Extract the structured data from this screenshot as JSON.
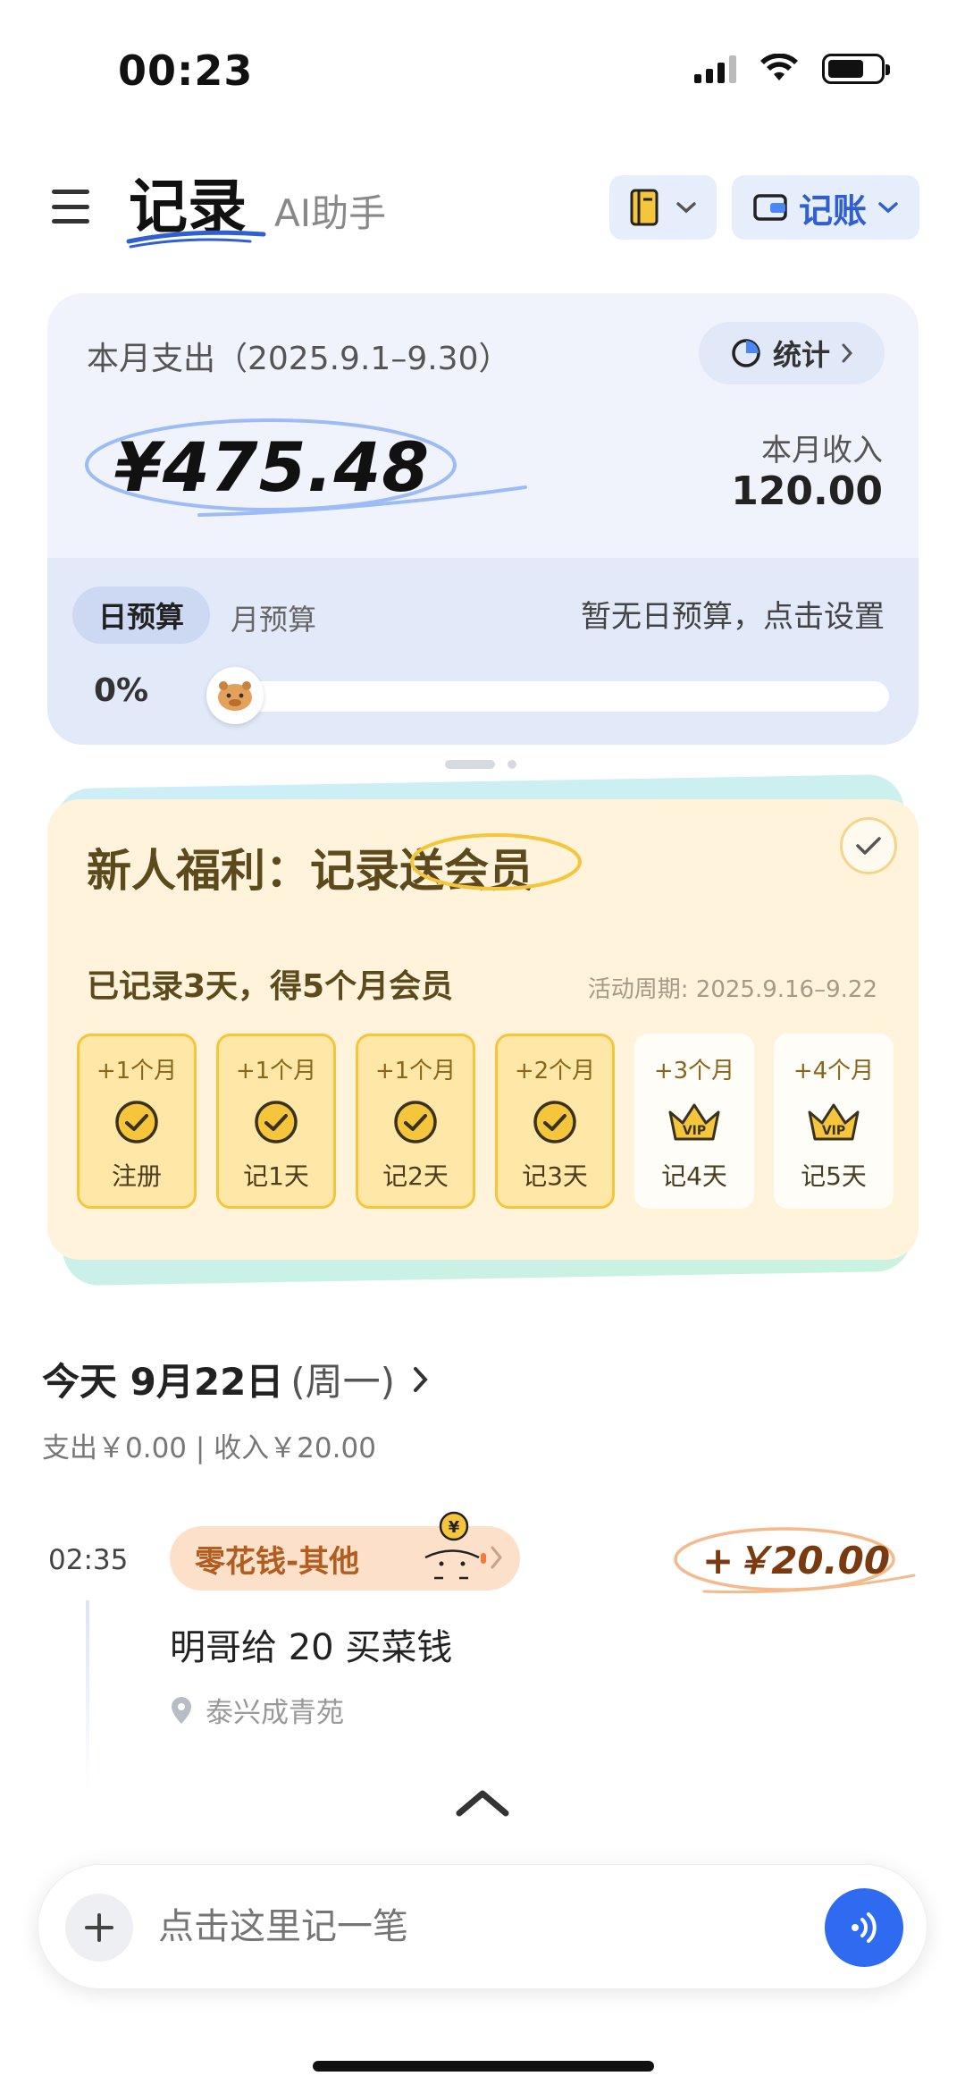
{
  "status_bar": {
    "time": "00:23"
  },
  "header": {
    "tab_record": "记录",
    "tab_ai": "AI助手",
    "account_label": "记账"
  },
  "summary": {
    "title": "本月支出（2025.9.1–9.30）",
    "stats_label": "统计",
    "amount": "¥475.48",
    "income_label": "本月收入",
    "income_value": "120.00",
    "budget_tab_day": "日预算",
    "budget_tab_month": "月预算",
    "budget_hint": "暂无日预算，点击设置",
    "budget_percent": "0%",
    "budget_progress": 0
  },
  "benefit": {
    "title_prefix": "新人福利：记录",
    "title_highlight": "送会员",
    "subtitle": "已记录3天，得5个月会员",
    "period": "活动周期: 2025.9.16–9.22",
    "rewards": [
      {
        "plus": "+1个月",
        "label": "注册",
        "status": "done"
      },
      {
        "plus": "+1个月",
        "label": "记1天",
        "status": "done"
      },
      {
        "plus": "+1个月",
        "label": "记2天",
        "status": "done"
      },
      {
        "plus": "+2个月",
        "label": "记3天",
        "status": "done"
      },
      {
        "plus": "+3个月",
        "label": "记4天",
        "status": "vip"
      },
      {
        "plus": "+4个月",
        "label": "记5天",
        "status": "vip"
      }
    ]
  },
  "today": {
    "title": "今天 9月22日",
    "weekday": "(周一)",
    "summary": "支出￥0.00  |  收入￥20.00"
  },
  "transaction": {
    "time": "02:35",
    "category": "零花钱-其他",
    "amount": "+￥20.00",
    "note": "明哥给 20 买菜钱",
    "location": "泰兴成青苑"
  },
  "input_bar": {
    "placeholder": "点击这里记一笔"
  },
  "colors": {
    "accent": "#2f6bf0",
    "gold": "#f5c53b",
    "income_orange": "#b25c20"
  }
}
